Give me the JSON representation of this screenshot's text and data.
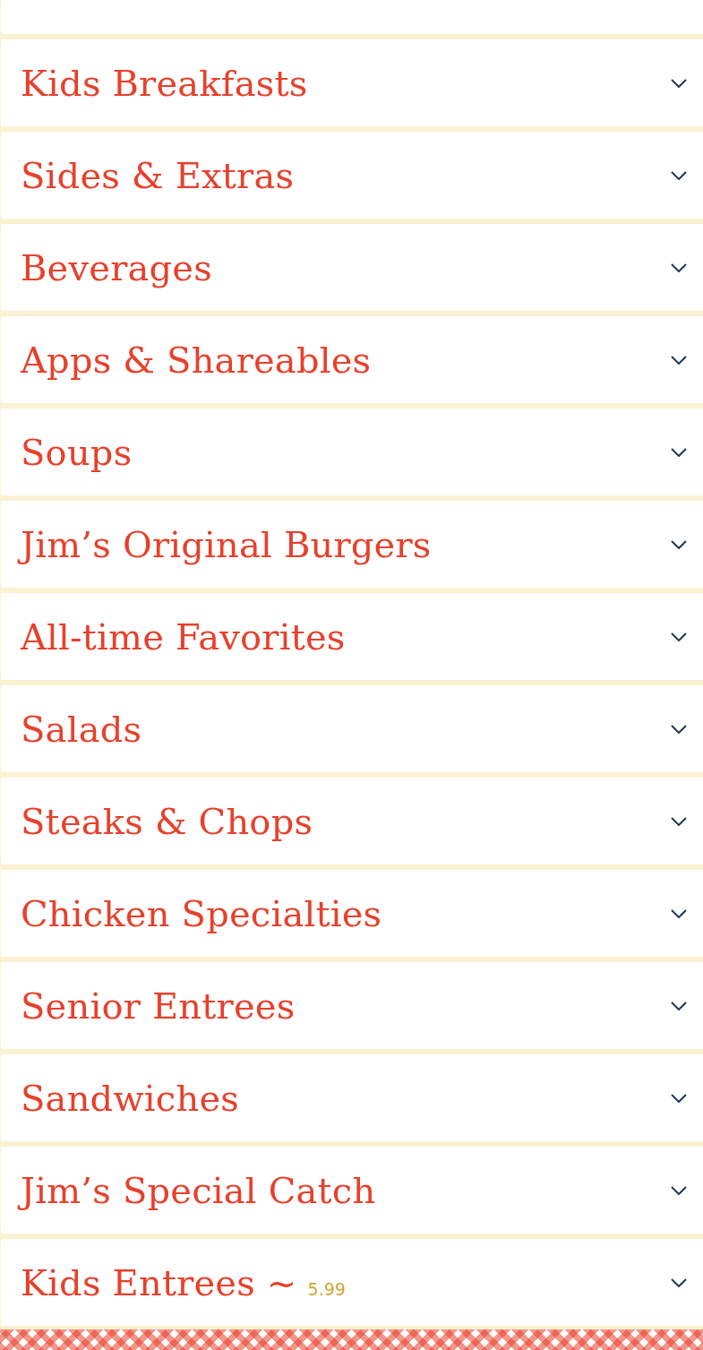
{
  "categories": [
    {
      "title": "Kids Breakfasts",
      "expanded": false
    },
    {
      "title": "Sides & Extras",
      "expanded": false
    },
    {
      "title": "Beverages",
      "expanded": false
    },
    {
      "title": "Apps & Shareables",
      "expanded": false
    },
    {
      "title": "Soups",
      "expanded": false
    },
    {
      "title": "Jim’s Original Burgers",
      "expanded": false
    },
    {
      "title": "All-time Favorites",
      "expanded": false
    },
    {
      "title": "Salads",
      "expanded": false
    },
    {
      "title": "Steaks & Chops",
      "expanded": false
    },
    {
      "title": "Chicken Specialties",
      "expanded": false
    },
    {
      "title": "Senior Entrees",
      "expanded": false
    },
    {
      "title": "Sandwiches",
      "expanded": false
    },
    {
      "title": "Jim’s Special Catch",
      "expanded": false
    },
    {
      "title": "Kids Entrees ~",
      "price": "5.99",
      "expanded": false
    }
  ]
}
